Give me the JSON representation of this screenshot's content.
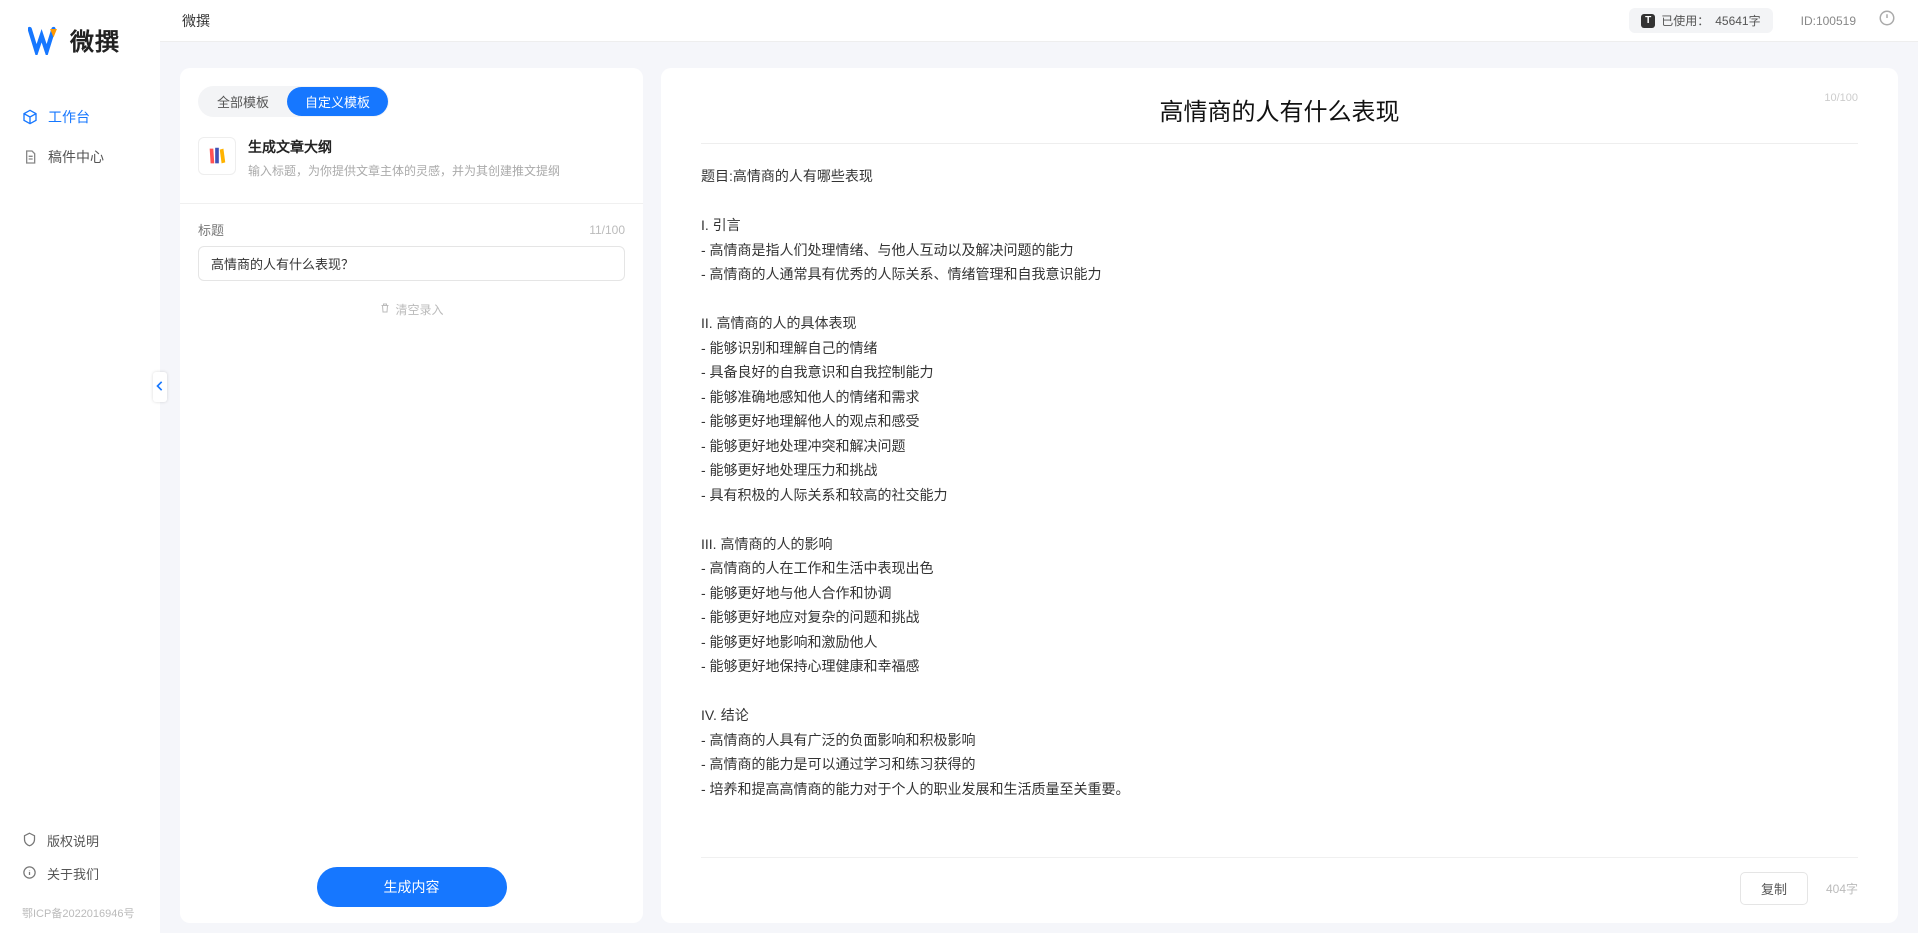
{
  "brand": {
    "name": "微撰"
  },
  "sidebar": {
    "nav": [
      {
        "label": "工作台",
        "active": true
      },
      {
        "label": "稿件中心",
        "active": false
      }
    ],
    "bottom": [
      {
        "label": "版权说明"
      },
      {
        "label": "关于我们"
      }
    ],
    "icp": "鄂ICP备2022016946号"
  },
  "topbar": {
    "title": "微撰",
    "usage_label": "已使用：",
    "usage_value": "45641字",
    "id_label": "ID:100519"
  },
  "left": {
    "tabs": [
      {
        "label": "全部模板",
        "active": false
      },
      {
        "label": "自定义模板",
        "active": true
      }
    ],
    "template": {
      "title": "生成文章大纲",
      "desc": "输入标题，为你提供文章主体的灵感，并为其创建推文提纲"
    },
    "field": {
      "label": "标题",
      "counter": "11/100",
      "value": "高情商的人有什么表现？"
    },
    "clear_label": "清空录入",
    "generate_label": "生成内容"
  },
  "right": {
    "title": "高情商的人有什么表现",
    "title_counter": "10/100",
    "body": "题目:高情商的人有哪些表现\n\nI. 引言\n- 高情商是指人们处理情绪、与他人互动以及解决问题的能力\n- 高情商的人通常具有优秀的人际关系、情绪管理和自我意识能力\n\nII. 高情商的人的具体表现\n- 能够识别和理解自己的情绪\n- 具备良好的自我意识和自我控制能力\n- 能够准确地感知他人的情绪和需求\n- 能够更好地理解他人的观点和感受\n- 能够更好地处理冲突和解决问题\n- 能够更好地处理压力和挑战\n- 具有积极的人际关系和较高的社交能力\n\nIII. 高情商的人的影响\n- 高情商的人在工作和生活中表现出色\n- 能够更好地与他人合作和协调\n- 能够更好地应对复杂的问题和挑战\n- 能够更好地影响和激励他人\n- 能够更好地保持心理健康和幸福感\n\nIV. 结论\n- 高情商的人具有广泛的负面影响和积极影响\n- 高情商的能力是可以通过学习和练习获得的\n- 培养和提高高情商的能力对于个人的职业发展和生活质量至关重要。",
    "copy_label": "复制",
    "word_count": "404字"
  }
}
